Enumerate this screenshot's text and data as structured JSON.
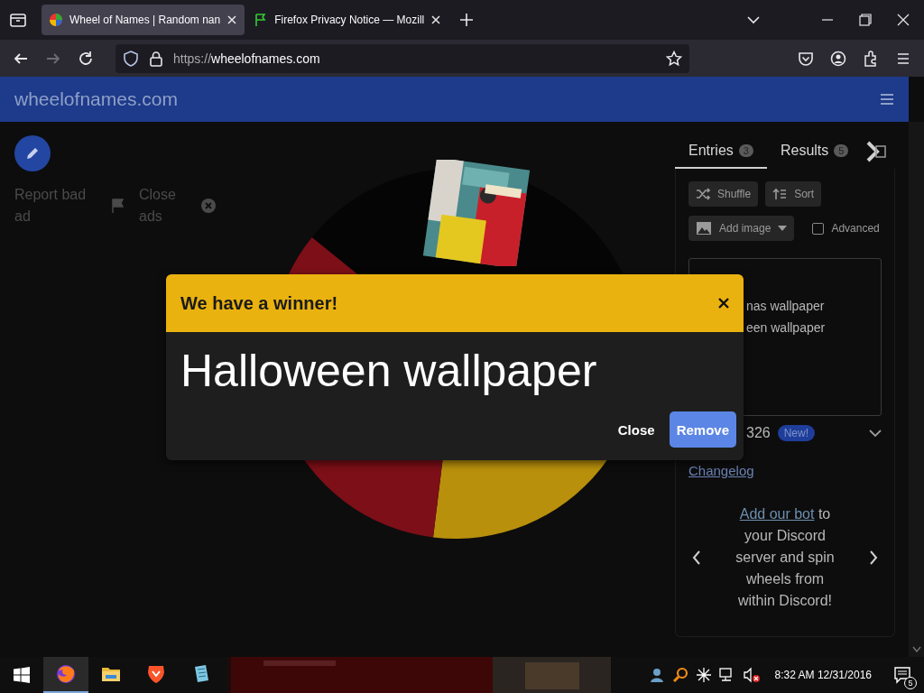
{
  "browser": {
    "tabs": [
      {
        "title": "Wheel of Names | Random nan",
        "kind": "wheel",
        "selected": true
      },
      {
        "title": "Firefox Privacy Notice — Mozill",
        "kind": "flag",
        "selected": false
      }
    ],
    "url_scheme": "https://",
    "url_host": "wheelofnames.com"
  },
  "site": {
    "title": "wheelofnames.com"
  },
  "ad_controls": [
    {
      "label": "Report bad ad",
      "kind": "flag"
    },
    {
      "label": "Close ads",
      "kind": "close"
    }
  ],
  "panel": {
    "tabs": [
      {
        "label": "Entries",
        "count": "3",
        "selected": true
      },
      {
        "label": "Results",
        "count": "5",
        "selected": false
      }
    ],
    "actions": [
      {
        "label": "Shuffle",
        "kind": "shuffle"
      },
      {
        "label": "Sort",
        "kind": "sort"
      }
    ],
    "add_image": "Add image",
    "advanced": {
      "label": "Advanced",
      "checked": false
    },
    "entries": [
      "nas wallpaper",
      "een wallpaper"
    ],
    "version": "326",
    "version_badge": "New!",
    "changelog": "Changelog",
    "promo": {
      "link": "Add our bot",
      "text": " to your Discord server and spin wheels from within Discord!"
    }
  },
  "dialog": {
    "title": "We have a winner!",
    "winner": "Halloween wallpaper",
    "buttons": [
      {
        "label": "Close",
        "kind": "text"
      },
      {
        "label": "Remove",
        "kind": "primary"
      }
    ]
  },
  "taskbar": {
    "apps": [
      {
        "kind": "firefox",
        "active": true
      },
      {
        "kind": "folder",
        "active": false
      },
      {
        "kind": "lion",
        "active": false
      },
      {
        "kind": "notepad",
        "active": false
      }
    ],
    "clock": "8:32 AM 12/31/2016",
    "notifications": "5"
  }
}
